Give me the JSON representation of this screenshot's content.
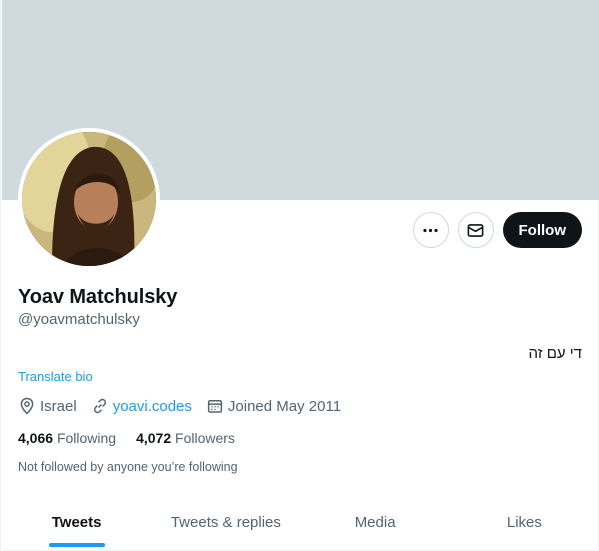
{
  "profile": {
    "name": "Yoav Matchulsky",
    "handle": "@yoavmatchulsky",
    "bio": "די עם זה",
    "translate_label": "Translate bio",
    "location": "Israel",
    "website": "yoavi.codes",
    "joined": "Joined May 2011",
    "following_count": "4,066",
    "following_label": "Following",
    "followers_count": "4,072",
    "followers_label": "Followers",
    "not_followed_text": "Not followed by anyone you’re following"
  },
  "actions": {
    "more_icon": "more-horizontal-icon",
    "message_icon": "envelope-icon",
    "follow_label": "Follow"
  },
  "tabs": [
    {
      "label": "Tweets",
      "active": true
    },
    {
      "label": "Tweets & replies",
      "active": false
    },
    {
      "label": "Media",
      "active": false
    },
    {
      "label": "Likes",
      "active": false
    }
  ],
  "colors": {
    "banner": "#cfd9de",
    "accent": "#1d9bf0",
    "follow_bg": "#0f1419",
    "secondary_text": "#536471"
  }
}
